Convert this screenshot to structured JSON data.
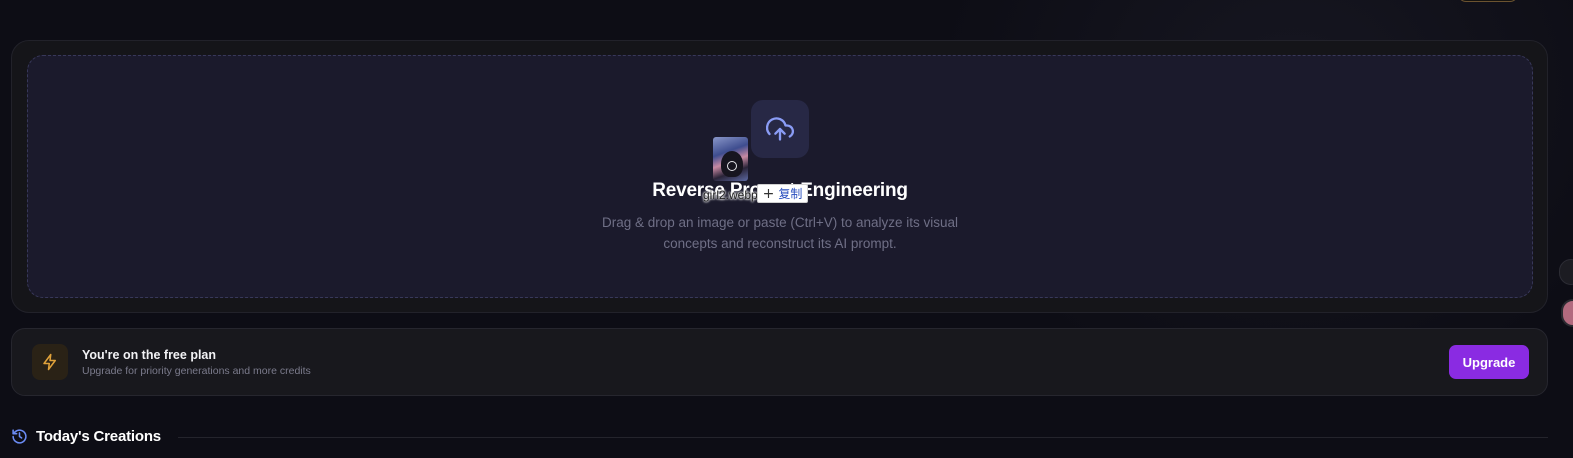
{
  "dropzone": {
    "title": "Reverse Prompt Engineering",
    "description": "Drag & drop an image or paste (Ctrl+V) to analyze its visual concepts and reconstruct its AI prompt.",
    "icon": "cloud-upload-icon"
  },
  "drag_ghost": {
    "filename": "girl2.webp",
    "badge_label": "复制",
    "badge_icon": "plus-icon"
  },
  "plan": {
    "title": "You're on the free plan",
    "subtitle": "Upgrade for priority generations and more credits",
    "icon": "lightning-icon",
    "upgrade_label": "Upgrade"
  },
  "today": {
    "title": "Today's Creations",
    "icon": "history-icon"
  },
  "colors": {
    "accent_purple": "#8a2be2",
    "upload_icon": "#8a9cf5",
    "lightning": "#e0a23a",
    "history_icon": "#6b8cf5"
  }
}
